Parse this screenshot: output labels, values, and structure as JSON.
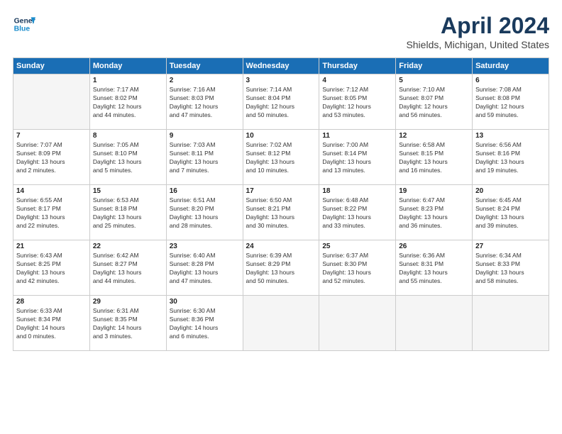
{
  "header": {
    "logo_line1": "General",
    "logo_line2": "Blue",
    "title": "April 2024",
    "subtitle": "Shields, Michigan, United States"
  },
  "weekdays": [
    "Sunday",
    "Monday",
    "Tuesday",
    "Wednesday",
    "Thursday",
    "Friday",
    "Saturday"
  ],
  "weeks": [
    [
      {
        "day": "",
        "lines": []
      },
      {
        "day": "1",
        "lines": [
          "Sunrise: 7:17 AM",
          "Sunset: 8:02 PM",
          "Daylight: 12 hours",
          "and 44 minutes."
        ]
      },
      {
        "day": "2",
        "lines": [
          "Sunrise: 7:16 AM",
          "Sunset: 8:03 PM",
          "Daylight: 12 hours",
          "and 47 minutes."
        ]
      },
      {
        "day": "3",
        "lines": [
          "Sunrise: 7:14 AM",
          "Sunset: 8:04 PM",
          "Daylight: 12 hours",
          "and 50 minutes."
        ]
      },
      {
        "day": "4",
        "lines": [
          "Sunrise: 7:12 AM",
          "Sunset: 8:05 PM",
          "Daylight: 12 hours",
          "and 53 minutes."
        ]
      },
      {
        "day": "5",
        "lines": [
          "Sunrise: 7:10 AM",
          "Sunset: 8:07 PM",
          "Daylight: 12 hours",
          "and 56 minutes."
        ]
      },
      {
        "day": "6",
        "lines": [
          "Sunrise: 7:08 AM",
          "Sunset: 8:08 PM",
          "Daylight: 12 hours",
          "and 59 minutes."
        ]
      }
    ],
    [
      {
        "day": "7",
        "lines": [
          "Sunrise: 7:07 AM",
          "Sunset: 8:09 PM",
          "Daylight: 13 hours",
          "and 2 minutes."
        ]
      },
      {
        "day": "8",
        "lines": [
          "Sunrise: 7:05 AM",
          "Sunset: 8:10 PM",
          "Daylight: 13 hours",
          "and 5 minutes."
        ]
      },
      {
        "day": "9",
        "lines": [
          "Sunrise: 7:03 AM",
          "Sunset: 8:11 PM",
          "Daylight: 13 hours",
          "and 7 minutes."
        ]
      },
      {
        "day": "10",
        "lines": [
          "Sunrise: 7:02 AM",
          "Sunset: 8:12 PM",
          "Daylight: 13 hours",
          "and 10 minutes."
        ]
      },
      {
        "day": "11",
        "lines": [
          "Sunrise: 7:00 AM",
          "Sunset: 8:14 PM",
          "Daylight: 13 hours",
          "and 13 minutes."
        ]
      },
      {
        "day": "12",
        "lines": [
          "Sunrise: 6:58 AM",
          "Sunset: 8:15 PM",
          "Daylight: 13 hours",
          "and 16 minutes."
        ]
      },
      {
        "day": "13",
        "lines": [
          "Sunrise: 6:56 AM",
          "Sunset: 8:16 PM",
          "Daylight: 13 hours",
          "and 19 minutes."
        ]
      }
    ],
    [
      {
        "day": "14",
        "lines": [
          "Sunrise: 6:55 AM",
          "Sunset: 8:17 PM",
          "Daylight: 13 hours",
          "and 22 minutes."
        ]
      },
      {
        "day": "15",
        "lines": [
          "Sunrise: 6:53 AM",
          "Sunset: 8:18 PM",
          "Daylight: 13 hours",
          "and 25 minutes."
        ]
      },
      {
        "day": "16",
        "lines": [
          "Sunrise: 6:51 AM",
          "Sunset: 8:20 PM",
          "Daylight: 13 hours",
          "and 28 minutes."
        ]
      },
      {
        "day": "17",
        "lines": [
          "Sunrise: 6:50 AM",
          "Sunset: 8:21 PM",
          "Daylight: 13 hours",
          "and 30 minutes."
        ]
      },
      {
        "day": "18",
        "lines": [
          "Sunrise: 6:48 AM",
          "Sunset: 8:22 PM",
          "Daylight: 13 hours",
          "and 33 minutes."
        ]
      },
      {
        "day": "19",
        "lines": [
          "Sunrise: 6:47 AM",
          "Sunset: 8:23 PM",
          "Daylight: 13 hours",
          "and 36 minutes."
        ]
      },
      {
        "day": "20",
        "lines": [
          "Sunrise: 6:45 AM",
          "Sunset: 8:24 PM",
          "Daylight: 13 hours",
          "and 39 minutes."
        ]
      }
    ],
    [
      {
        "day": "21",
        "lines": [
          "Sunrise: 6:43 AM",
          "Sunset: 8:25 PM",
          "Daylight: 13 hours",
          "and 42 minutes."
        ]
      },
      {
        "day": "22",
        "lines": [
          "Sunrise: 6:42 AM",
          "Sunset: 8:27 PM",
          "Daylight: 13 hours",
          "and 44 minutes."
        ]
      },
      {
        "day": "23",
        "lines": [
          "Sunrise: 6:40 AM",
          "Sunset: 8:28 PM",
          "Daylight: 13 hours",
          "and 47 minutes."
        ]
      },
      {
        "day": "24",
        "lines": [
          "Sunrise: 6:39 AM",
          "Sunset: 8:29 PM",
          "Daylight: 13 hours",
          "and 50 minutes."
        ]
      },
      {
        "day": "25",
        "lines": [
          "Sunrise: 6:37 AM",
          "Sunset: 8:30 PM",
          "Daylight: 13 hours",
          "and 52 minutes."
        ]
      },
      {
        "day": "26",
        "lines": [
          "Sunrise: 6:36 AM",
          "Sunset: 8:31 PM",
          "Daylight: 13 hours",
          "and 55 minutes."
        ]
      },
      {
        "day": "27",
        "lines": [
          "Sunrise: 6:34 AM",
          "Sunset: 8:33 PM",
          "Daylight: 13 hours",
          "and 58 minutes."
        ]
      }
    ],
    [
      {
        "day": "28",
        "lines": [
          "Sunrise: 6:33 AM",
          "Sunset: 8:34 PM",
          "Daylight: 14 hours",
          "and 0 minutes."
        ]
      },
      {
        "day": "29",
        "lines": [
          "Sunrise: 6:31 AM",
          "Sunset: 8:35 PM",
          "Daylight: 14 hours",
          "and 3 minutes."
        ]
      },
      {
        "day": "30",
        "lines": [
          "Sunrise: 6:30 AM",
          "Sunset: 8:36 PM",
          "Daylight: 14 hours",
          "and 6 minutes."
        ]
      },
      {
        "day": "",
        "lines": []
      },
      {
        "day": "",
        "lines": []
      },
      {
        "day": "",
        "lines": []
      },
      {
        "day": "",
        "lines": []
      }
    ]
  ]
}
